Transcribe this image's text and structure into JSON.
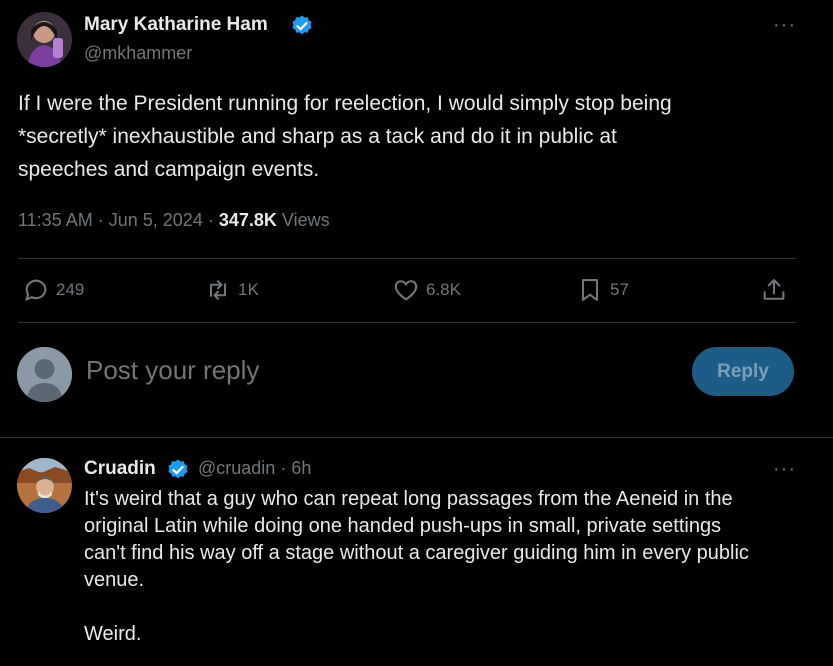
{
  "tweet": {
    "author_name": "Mary Katharine Ham",
    "author_handle": "@mkhammer",
    "more": "···",
    "text_lines": [
      "If I were the President running for reelection, I would simply stop being",
      "*secretly* inexhaustible and sharp as a tack and do it in public at",
      "speeches and campaign events."
    ],
    "time": "11:35 AM",
    "date": "Jun 5, 2024",
    "views_count": "347.8K",
    "views_label": "Views",
    "sep": "·"
  },
  "actions": {
    "replies": "249",
    "reposts": "1K",
    "likes": "6.8K",
    "bookmarks": "57"
  },
  "composer": {
    "placeholder": "Post your reply",
    "button": "Reply"
  },
  "reply": {
    "author_name": "Cruadin",
    "author_handle": "@cruadin",
    "sep": "·",
    "time": "6h",
    "more": "···",
    "text_lines": [
      "It's weird that a guy who can repeat long passages from the Aeneid in the",
      "original Latin while doing one handed push-ups in small, private settings",
      "can't find his way off a stage without a caregiver guiding him in every public",
      "venue."
    ],
    "text_last": "Weird."
  },
  "colors": {
    "background": "#000000",
    "verified": "#1d9bf0",
    "muted": "#71767b",
    "reply_button": "#1c5c86"
  }
}
